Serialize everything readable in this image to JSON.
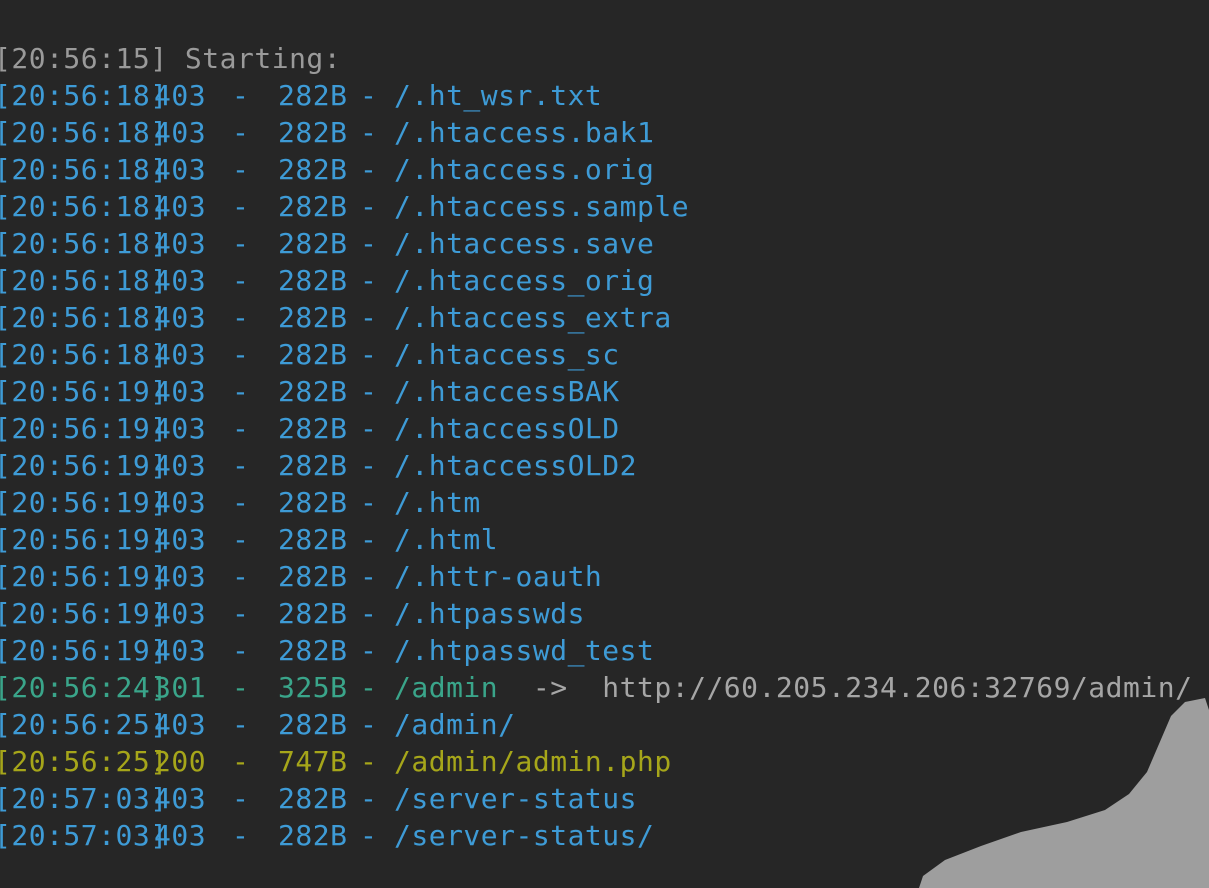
{
  "colors": {
    "background": "#262626",
    "status_403": "#3e9bd6",
    "status_301": "#3aa58a",
    "status_200": "#a6a61a",
    "info_text": "#9a9a9a",
    "redirect_text": "#a6a6a6",
    "overlay_shape": "#9e9e9e"
  },
  "start_line": "[20:56:15] Starting:",
  "entries": [
    {
      "timestamp": "[20:56:18]",
      "code": "403",
      "dash": "-",
      "size": "282B",
      "sep": "-",
      "path": "/.ht_wsr.txt"
    },
    {
      "timestamp": "[20:56:18]",
      "code": "403",
      "dash": "-",
      "size": "282B",
      "sep": "-",
      "path": "/.htaccess.bak1"
    },
    {
      "timestamp": "[20:56:18]",
      "code": "403",
      "dash": "-",
      "size": "282B",
      "sep": "-",
      "path": "/.htaccess.orig"
    },
    {
      "timestamp": "[20:56:18]",
      "code": "403",
      "dash": "-",
      "size": "282B",
      "sep": "-",
      "path": "/.htaccess.sample"
    },
    {
      "timestamp": "[20:56:18]",
      "code": "403",
      "dash": "-",
      "size": "282B",
      "sep": "-",
      "path": "/.htaccess.save"
    },
    {
      "timestamp": "[20:56:18]",
      "code": "403",
      "dash": "-",
      "size": "282B",
      "sep": "-",
      "path": "/.htaccess_orig"
    },
    {
      "timestamp": "[20:56:18]",
      "code": "403",
      "dash": "-",
      "size": "282B",
      "sep": "-",
      "path": "/.htaccess_extra"
    },
    {
      "timestamp": "[20:56:18]",
      "code": "403",
      "dash": "-",
      "size": "282B",
      "sep": "-",
      "path": "/.htaccess_sc"
    },
    {
      "timestamp": "[20:56:19]",
      "code": "403",
      "dash": "-",
      "size": "282B",
      "sep": "-",
      "path": "/.htaccessBAK"
    },
    {
      "timestamp": "[20:56:19]",
      "code": "403",
      "dash": "-",
      "size": "282B",
      "sep": "-",
      "path": "/.htaccessOLD"
    },
    {
      "timestamp": "[20:56:19]",
      "code": "403",
      "dash": "-",
      "size": "282B",
      "sep": "-",
      "path": "/.htaccessOLD2"
    },
    {
      "timestamp": "[20:56:19]",
      "code": "403",
      "dash": "-",
      "size": "282B",
      "sep": "-",
      "path": "/.htm"
    },
    {
      "timestamp": "[20:56:19]",
      "code": "403",
      "dash": "-",
      "size": "282B",
      "sep": "-",
      "path": "/.html"
    },
    {
      "timestamp": "[20:56:19]",
      "code": "403",
      "dash": "-",
      "size": "282B",
      "sep": "-",
      "path": "/.httr-oauth"
    },
    {
      "timestamp": "[20:56:19]",
      "code": "403",
      "dash": "-",
      "size": "282B",
      "sep": "-",
      "path": "/.htpasswds"
    },
    {
      "timestamp": "[20:56:19]",
      "code": "403",
      "dash": "-",
      "size": "282B",
      "sep": "-",
      "path": "/.htpasswd_test"
    },
    {
      "timestamp": "[20:56:24]",
      "code": "301",
      "dash": "-",
      "size": "325B",
      "sep": "-",
      "path": "/admin",
      "redirect": "  ->  http://60.205.234.206:32769/admin/"
    },
    {
      "timestamp": "[20:56:25]",
      "code": "403",
      "dash": "-",
      "size": "282B",
      "sep": "-",
      "path": "/admin/"
    },
    {
      "timestamp": "[20:56:25]",
      "code": "200",
      "dash": "-",
      "size": "747B",
      "sep": "-",
      "path": "/admin/admin.php"
    },
    {
      "timestamp": "[20:57:03]",
      "code": "403",
      "dash": "-",
      "size": "282B",
      "sep": "-",
      "path": "/server-status"
    },
    {
      "timestamp": "[20:57:03]",
      "code": "403",
      "dash": "-",
      "size": "282B",
      "sep": "-",
      "path": "/server-status/"
    }
  ]
}
